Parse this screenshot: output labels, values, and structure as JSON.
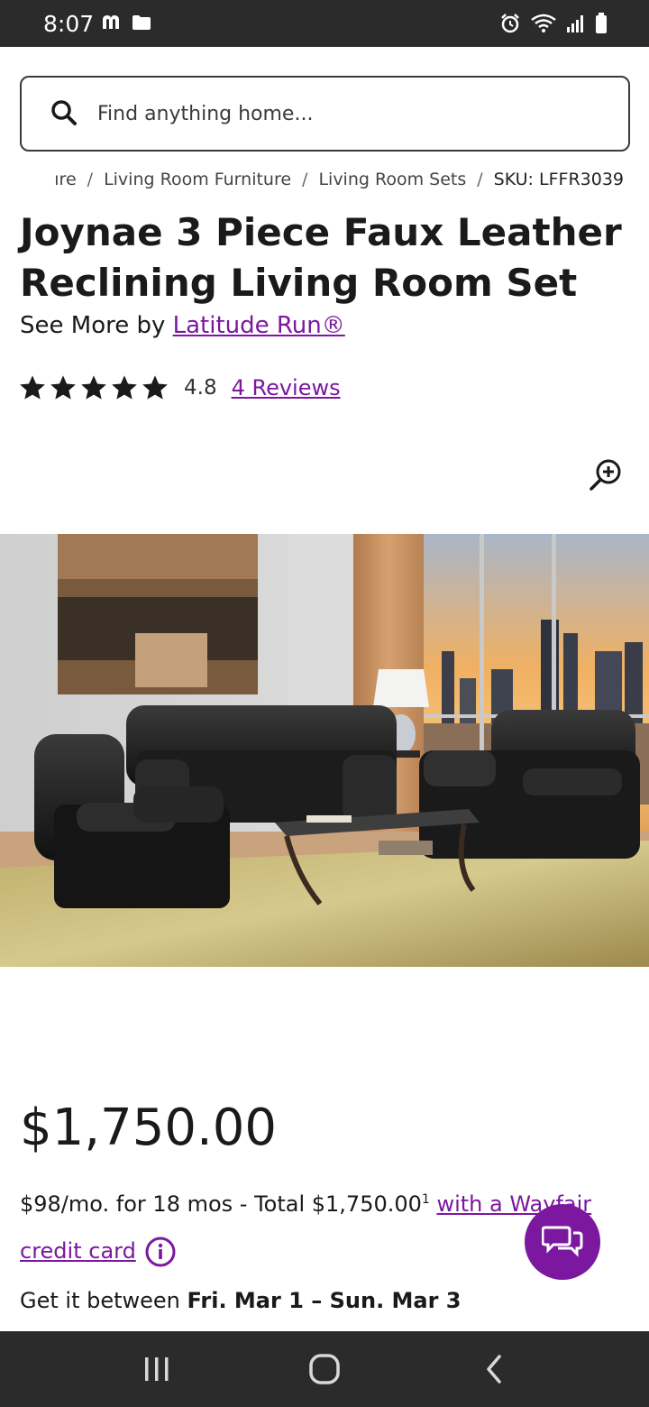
{
  "status_bar": {
    "time": "8:07"
  },
  "search": {
    "placeholder": "Find anything home..."
  },
  "breadcrumb": {
    "items": [
      "ıre",
      "Living Room Furniture",
      "Living Room Sets"
    ],
    "sku": "SKU: LFFR3039"
  },
  "product": {
    "title": "Joynae 3 Piece Faux Leather Reclining Living Room Set",
    "see_more_prefix": "See More by ",
    "brand": "Latitude Run®",
    "rating": "4.8",
    "rating_stars": 4.8,
    "reviews": "4 Reviews",
    "price": "$1,750.00"
  },
  "financing": {
    "text": "$98/mo. for 18 mos - Total $1,750.00",
    "footnote": "1",
    "link": "with a Wayfair credit card"
  },
  "delivery": {
    "prefix": "Get it between ",
    "dates": "Fri. Mar 1 – Sun. Mar 3"
  },
  "colors": {
    "accent": "#7b189f",
    "status_bar": "#2b2b2b"
  },
  "icons": [
    "search-icon",
    "zoom-in-icon",
    "star-icon",
    "info-icon",
    "chat-icon",
    "recents-icon",
    "home-icon",
    "back-icon"
  ]
}
